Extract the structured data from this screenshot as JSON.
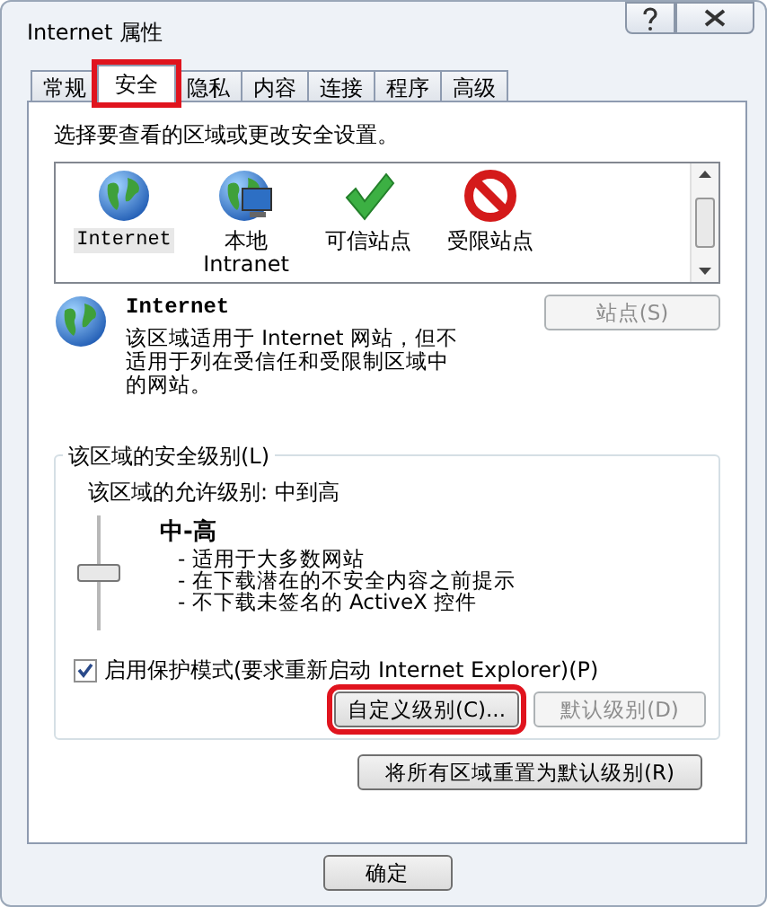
{
  "window": {
    "title": "Internet 属性"
  },
  "title_buttons": [
    {
      "kind": "help"
    },
    {
      "kind": "close"
    }
  ],
  "tabs": [
    {
      "label": "常规",
      "selected": false,
      "highlighted": false
    },
    {
      "label": "安全",
      "selected": true,
      "highlighted": true
    },
    {
      "label": "隐私",
      "selected": false,
      "highlighted": false
    },
    {
      "label": "内容",
      "selected": false,
      "highlighted": false
    },
    {
      "label": "连接",
      "selected": false,
      "highlighted": false
    },
    {
      "label": "程序",
      "selected": false,
      "highlighted": false
    },
    {
      "label": "高级",
      "selected": false,
      "highlighted": false
    }
  ],
  "zones_prompt": "选择要查看的区域或更改安全设置。",
  "zones": [
    {
      "kind": "internet",
      "label": "Internet",
      "selected": true
    },
    {
      "kind": "intranet",
      "label": "本地\nIntranet",
      "selected": false
    },
    {
      "kind": "trusted",
      "label": "可信站点",
      "selected": false
    },
    {
      "kind": "restricted",
      "label": "受限站点",
      "selected": false
    }
  ],
  "zone_info": {
    "name": "Internet",
    "description": "该区域适用于 Internet 网站，但不适用于列在受信任和受限制区域中的网站。",
    "sites_button": {
      "label": "站点(S)",
      "disabled": true
    }
  },
  "security_level": {
    "legend": "该区域的安全级别(L)",
    "allowed": "该区域的允许级别: 中到高",
    "level": 0.5,
    "name": "中-高",
    "points": [
      "- 适用于大多数网站",
      "- 在下载潜在的不安全内容之前提示",
      "- 不下载未签名的 ActiveX 控件"
    ],
    "protected_mode": {
      "label": "启用保护模式(要求重新启动 Internet Explorer)(P)",
      "checked": true
    },
    "buttons": [
      {
        "label": "自定义级别(C)...",
        "disabled": false,
        "highlighted": true
      },
      {
        "label": "默认级别(D)",
        "disabled": true,
        "highlighted": false
      }
    ]
  },
  "reset_button": {
    "label": "将所有区域重置为默认级别(R)"
  },
  "footer_buttons": [
    {
      "label": "确定"
    }
  ]
}
